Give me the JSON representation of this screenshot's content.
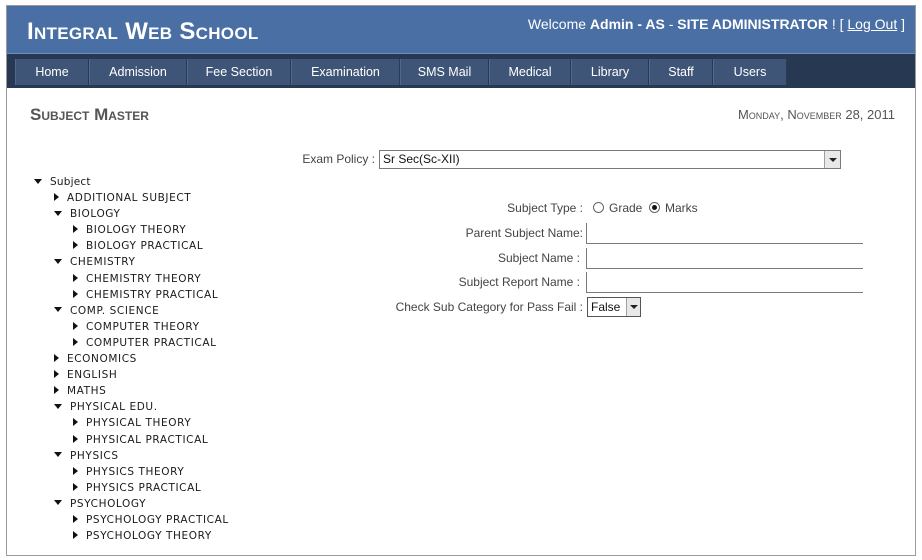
{
  "app": {
    "logo": "Integral Web School",
    "welcome_prefix": "Welcome ",
    "user": "Admin",
    "user_sep": " - ",
    "role": "AS",
    "role_sep": " - ",
    "designation": "SITE ADMINISTRATOR",
    "bang": " ! [ ",
    "logout_label": "Log Out",
    "close_bracket": " ]"
  },
  "nav": [
    "Home",
    "Admission",
    "Fee Section",
    "Examination",
    "SMS Mail",
    "Medical",
    "Library",
    "Staff",
    "Users"
  ],
  "page": {
    "title": "Subject Master",
    "date": "Monday, November 28, 2011"
  },
  "tree": {
    "root": "Subject",
    "items": [
      {
        "label": "ADDITIONAL SUBJECT",
        "level": 1,
        "expanded": false
      },
      {
        "label": "BIOLOGY",
        "level": 1,
        "expanded": true
      },
      {
        "label": "BIOLOGY THEORY",
        "level": 2,
        "expanded": false
      },
      {
        "label": "BIOLOGY PRACTICAL",
        "level": 2,
        "expanded": false
      },
      {
        "label": "CHEMISTRY",
        "level": 1,
        "expanded": true
      },
      {
        "label": "CHEMISTRY THEORY",
        "level": 2,
        "expanded": false
      },
      {
        "label": "CHEMISTRY PRACTICAL",
        "level": 2,
        "expanded": false
      },
      {
        "label": "COMP. SCIENCE",
        "level": 1,
        "expanded": true
      },
      {
        "label": "COMPUTER THEORY",
        "level": 2,
        "expanded": false
      },
      {
        "label": "COMPUTER PRACTICAL",
        "level": 2,
        "expanded": false
      },
      {
        "label": "ECONOMICS",
        "level": 1,
        "expanded": false
      },
      {
        "label": "ENGLISH",
        "level": 1,
        "expanded": false
      },
      {
        "label": "MATHS",
        "level": 1,
        "expanded": false
      },
      {
        "label": "PHYSICAL EDU.",
        "level": 1,
        "expanded": true
      },
      {
        "label": "PHYSICAL THEORY",
        "level": 2,
        "expanded": false
      },
      {
        "label": "PHYSICAL PRACTICAL",
        "level": 2,
        "expanded": false
      },
      {
        "label": "PHYSICS",
        "level": 1,
        "expanded": true
      },
      {
        "label": "PHYSICS THEORY",
        "level": 2,
        "expanded": false
      },
      {
        "label": "PHYSICS PRACTICAL",
        "level": 2,
        "expanded": false
      },
      {
        "label": "PSYCHOLOGY",
        "level": 1,
        "expanded": true
      },
      {
        "label": "PSYCHOLOGY PRACTICAL",
        "level": 2,
        "expanded": false
      },
      {
        "label": "PSYCHOLOGY THEORY",
        "level": 2,
        "expanded": false
      }
    ]
  },
  "form": {
    "exam_policy_label": "Exam Policy :",
    "exam_policy_value": "Sr Sec(Sc-XII)",
    "subject_type_label": "Subject Type :",
    "grade_label": "Grade",
    "marks_label": "Marks",
    "subject_type_selected": "Marks",
    "parent_subject_label": "Parent Subject Name:",
    "parent_subject_value": "",
    "subject_name_label": "Subject Name :",
    "subject_name_value": "",
    "report_name_label": "Subject Report Name :",
    "report_name_value": "",
    "pass_fail_label": "Check Sub Category for Pass Fail :",
    "pass_fail_value": "False"
  },
  "colors": {
    "header_bg": "#4a6fa5",
    "nav_bg": "#273852",
    "tab_bg": "#3e5577"
  }
}
